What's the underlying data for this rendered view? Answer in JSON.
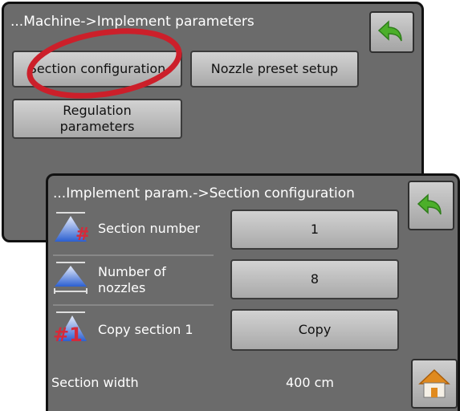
{
  "implement_screen": {
    "title": "...Machine->Implement parameters",
    "buttons": {
      "section_configuration": "Section configuration",
      "nozzle_preset_setup": "Nozzle preset setup",
      "regulation_parameters": "Regulation\nparameters"
    },
    "back_icon": "back-arrow-icon"
  },
  "section_screen": {
    "title": "...Implement param.->Section configuration",
    "rows": [
      {
        "icon": "section-number-icon",
        "label": "Section number",
        "value": "1"
      },
      {
        "icon": "number-of-nozzles-icon",
        "label": "Number of\nnozzles",
        "value": "8"
      },
      {
        "icon": "copy-section-icon",
        "label": "Copy section 1",
        "value": "Copy"
      }
    ],
    "section_width": {
      "label": "Section width",
      "value": "400 cm"
    },
    "back_icon": "back-arrow-icon",
    "home_icon": "home-icon"
  },
  "annotation": {
    "shape": "red ellipse",
    "color": "#cc1f2a"
  },
  "colors": {
    "panel": "#6b6b6b",
    "button": "#c0c0c0",
    "accent_green": "#4caf2a"
  }
}
